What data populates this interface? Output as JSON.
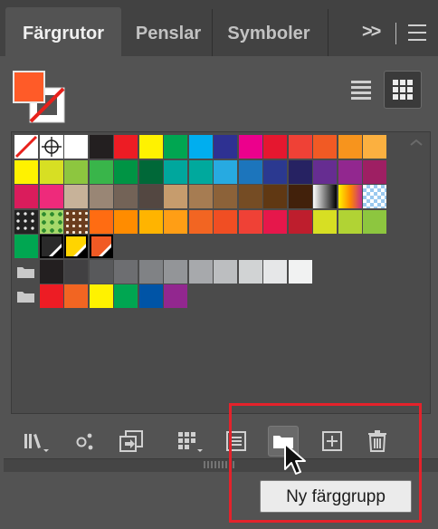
{
  "panel": {
    "tabs": [
      {
        "label": "Färgrutor",
        "active": true
      },
      {
        "label": "Penslar",
        "active": false
      },
      {
        "label": "Symboler",
        "active": false
      }
    ],
    "overflow_label": ">>",
    "fill_color": "#ff5b28",
    "stroke_color": "none"
  },
  "view_modes": [
    {
      "name": "list-view-icon",
      "active": false
    },
    {
      "name": "grid-view-icon",
      "active": true
    }
  ],
  "swatches": {
    "rows": [
      [
        {
          "kind": "none"
        },
        {
          "kind": "registration"
        },
        "#ffffff",
        "#231f20",
        "#ed1c24",
        "#fff200",
        "#00a651",
        "#00aeef",
        "#2e3192",
        "#ec008c",
        "#e5172f",
        "#ef4136",
        "#f15a24",
        "#f7941d",
        "#fbb040"
      ],
      [
        "#fff200",
        "#d7df23",
        "#8dc63f",
        "#39b54a",
        "#009444",
        "#006838",
        "#00a79d",
        "#00a99d",
        "#27aae1",
        "#1c75bc",
        "#2b3990",
        "#262262",
        "#662d91",
        "#92278f",
        "#9e1f63"
      ],
      [
        "#da1c5c",
        "#ee2a7b",
        "#c7b299",
        "#998675",
        "#736357",
        "#534741",
        "#c69c6d",
        "#a67c52",
        "#8c6239",
        "#754c24",
        "#603813",
        "#42210b",
        {
          "kind": "gradient-bw"
        },
        {
          "kind": "gradient-orange"
        },
        {
          "kind": "gradient-blue"
        }
      ],
      [
        {
          "kind": "pattern-dots"
        },
        {
          "kind": "pattern-leaves"
        },
        {
          "kind": "pattern-swirl"
        },
        "#ff6c12",
        "#ff8c00",
        "#ffb400",
        "#ff9e15",
        "#f26522",
        "#f04e23",
        "#ef4136",
        "#e6174b",
        "#be1e2d",
        "#d7df23",
        "#b1d334",
        "#8dc63f"
      ],
      [
        "#00a651",
        {
          "kind": "tint",
          "color": "#2a2a2a"
        },
        {
          "kind": "tint",
          "color": "#ffd400"
        },
        {
          "kind": "tint",
          "color": "#f15a24"
        }
      ],
      [
        {
          "kind": "folder"
        },
        "#231f20",
        "#414042",
        "#58595b",
        "#6d6e71",
        "#808285",
        "#939598",
        "#a7a9ac",
        "#bcbec0",
        "#d1d3d4",
        "#e6e7e8",
        "#f1f2f2"
      ],
      [
        {
          "kind": "folder"
        },
        "#ed1c24",
        "#f26522",
        "#fff200",
        "#00a651",
        "#0054a6",
        "#92278f"
      ]
    ]
  },
  "toolbar": {
    "buttons": [
      {
        "name": "swatch-libraries-menu-button",
        "icon": "libraries-icon"
      },
      {
        "name": "open-color-themes-button",
        "icon": "color-themes-icon"
      },
      {
        "name": "add-selected-to-library-button",
        "icon": "add-to-library-icon"
      },
      {
        "name": "show-swatch-kinds-button",
        "icon": "swatch-kinds-icon"
      },
      {
        "name": "swatch-options-button",
        "icon": "swatch-options-icon"
      },
      {
        "name": "new-color-group-button",
        "icon": "folder-icon",
        "active": true
      },
      {
        "name": "new-swatch-button",
        "icon": "plus-square-icon"
      },
      {
        "name": "delete-swatch-button",
        "icon": "trash-icon"
      }
    ]
  },
  "tooltip": {
    "text": "Ny färggrupp"
  },
  "highlight_color": "#e4222b"
}
